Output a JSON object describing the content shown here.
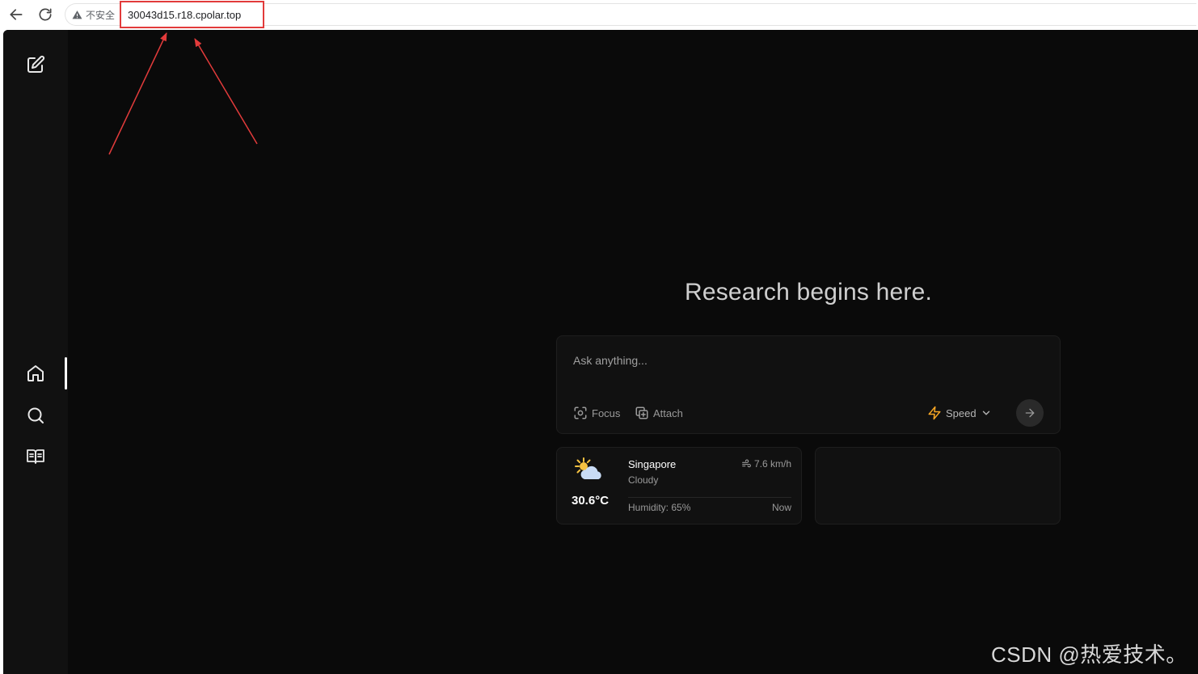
{
  "browser": {
    "security_label": "不安全",
    "url": "30043d15.r18.cpolar.top"
  },
  "sidebar": {
    "items": [
      {
        "name": "new-thread",
        "icon": "pencil-square-icon"
      },
      {
        "name": "home",
        "icon": "home-icon",
        "active": true
      },
      {
        "name": "discover",
        "icon": "search-icon"
      },
      {
        "name": "library",
        "icon": "book-open-icon"
      }
    ]
  },
  "main": {
    "headline": "Research begins here.",
    "search": {
      "placeholder": "Ask anything...",
      "value": ""
    },
    "toolbar": {
      "focus_label": "Focus",
      "attach_label": "Attach",
      "speed_label": "Speed"
    },
    "weather": {
      "city": "Singapore",
      "condition": "Cloudy",
      "temperature": "30.6°C",
      "wind": "7.6 km/h",
      "humidity": "Humidity: 65%",
      "time": "Now"
    }
  },
  "watermark": "CSDN @热爱技术。",
  "colors": {
    "background": "#0a0a0a",
    "sidebar": "#111111",
    "card": "#111111",
    "speed_accent": "#f5a524",
    "annotation": "#e23b3b"
  }
}
